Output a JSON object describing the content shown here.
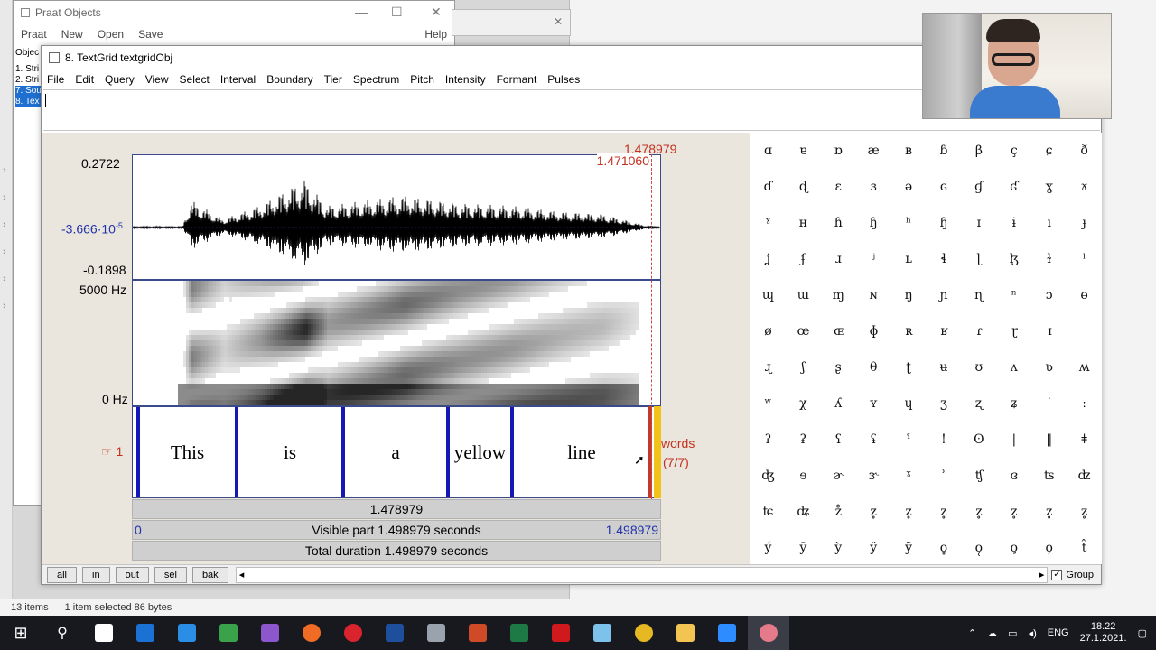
{
  "praat_objects": {
    "title": "Praat Objects",
    "menu": [
      "Praat",
      "New",
      "Open",
      "Save"
    ],
    "help": "Help",
    "list_header": "Objec",
    "objects": [
      "1. Stri",
      "2. Stri",
      "7. Sou",
      "8. Tex"
    ]
  },
  "editor": {
    "title": "8. TextGrid textgridObj",
    "menu": [
      "File",
      "Edit",
      "Query",
      "View",
      "Select",
      "Interval",
      "Boundary",
      "Tier",
      "Spectrum",
      "Pitch",
      "Intensity",
      "Formant",
      "Pulses"
    ],
    "cursor_top": "1.478979",
    "selection_time": "1.471060",
    "wave_max": "0.2722",
    "wave_mid": "-3.666·10",
    "wave_mid_exp": "-5",
    "wave_min": "-0.1898",
    "spec_max": "5000 Hz",
    "spec_min": "0 Hz",
    "tier_index": "1",
    "tier_name": "words",
    "tier_count": "(7/7)",
    "words": [
      "This",
      "is",
      "a",
      "yellow",
      "line"
    ],
    "cursor_bar": "1.478979",
    "visible_start": "0",
    "visible_label": "Visible part 1.498979 seconds",
    "visible_end": "1.498979",
    "total_label": "Total duration 1.498979 seconds",
    "buttons": [
      "all",
      "in",
      "out",
      "sel",
      "bak"
    ],
    "group_label": "Group"
  },
  "ipa_rows": [
    [
      "ɑ",
      "ɐ",
      "ɒ",
      "æ",
      "ʙ",
      "ɓ",
      "β",
      "ç",
      "ɕ",
      "ð"
    ],
    [
      "ɗ",
      "ɖ",
      "ɛ",
      "ɜ",
      "ə",
      "ɢ",
      "ɠ",
      "ʛ",
      "ɣ",
      "ɤ"
    ],
    [
      "ˠ",
      "ʜ",
      "ɦ",
      "ɧ",
      "ʰ",
      "ɧ",
      "ɪ",
      "ɨ",
      "ı",
      "ɟ"
    ],
    [
      "ʝ",
      "ʄ",
      "ɹ",
      "ʲ",
      "ʟ",
      "ɬ",
      "ɭ",
      "ɮ",
      "ɫ",
      "ˡ"
    ],
    [
      "ɰ",
      "ɯ",
      "ɱ",
      "ɴ",
      "ŋ",
      "ɲ",
      "ɳ",
      "ⁿ",
      "ɔ",
      "ɵ"
    ],
    [
      "ø",
      "œ",
      "ɶ",
      "ɸ",
      "ʀ",
      "ʁ",
      "ɾ",
      "ɽ",
      "ɪ"
    ],
    [
      "ɻ",
      "ʃ",
      "ʂ",
      "θ",
      "ʈ",
      "ʉ",
      "ʊ",
      "ʌ",
      "ʋ",
      "ʍ"
    ],
    [
      "ʷ",
      "χ",
      "ʎ",
      "ʏ",
      "ɥ",
      "ʒ",
      "ʐ",
      "ʑ",
      "˙",
      "ː"
    ],
    [
      "ʔ",
      "ʡ",
      "ʕ",
      "ʢ",
      "ˤ",
      "!",
      "ʘ",
      "|",
      "‖",
      "ǂ"
    ],
    [
      "ʤ",
      "ɘ",
      "ɚ",
      "ɝ",
      "ˠ",
      "ʾ",
      "ʧ",
      "ɞ",
      "ʦ",
      "ʣ"
    ],
    [
      "ʨ",
      "ʥ",
      "z̊",
      "z̥",
      "z̥",
      "z̥",
      "z̥",
      "z̥",
      "z̥",
      "z̥"
    ],
    [
      "ý",
      "ȳ",
      "ỳ",
      "ÿ",
      "ỹ",
      "o̥",
      "o̜",
      "o̧",
      "o̦",
      "t̂"
    ]
  ],
  "status": {
    "items": "13 items",
    "selected": "1 item selected 86 bytes"
  },
  "taskbar": {
    "lang": "ENG",
    "time": "18.22",
    "date": "27.1.2021."
  },
  "colors": {
    "boundary": "#1418b6",
    "cursor_red": "#c3301e",
    "selected_blue": "#2233aa",
    "tier_yellow": "#f2c21a"
  }
}
